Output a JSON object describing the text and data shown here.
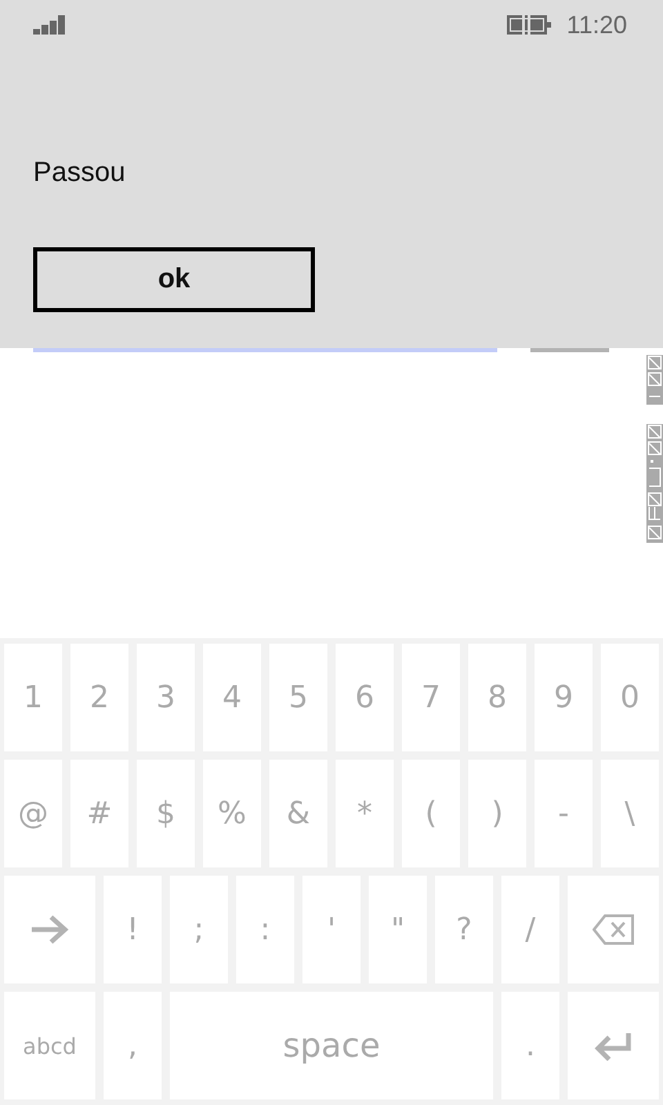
{
  "status_bar": {
    "time": "11:20"
  },
  "dialog": {
    "message": "Passou",
    "button": "ok"
  },
  "keyboard": {
    "key_rows": [
      {
        "keys": [
          {
            "kind": "char",
            "label": "1"
          },
          {
            "kind": "char",
            "label": "2"
          },
          {
            "kind": "char",
            "label": "3"
          },
          {
            "kind": "char",
            "label": "4"
          },
          {
            "kind": "char",
            "label": "5"
          },
          {
            "kind": "char",
            "label": "6"
          },
          {
            "kind": "char",
            "label": "7"
          },
          {
            "kind": "char",
            "label": "8"
          },
          {
            "kind": "char",
            "label": "9"
          },
          {
            "kind": "char",
            "label": "0"
          }
        ]
      },
      {
        "keys": [
          {
            "kind": "char",
            "label": "@"
          },
          {
            "kind": "char",
            "label": "#"
          },
          {
            "kind": "char",
            "label": "$"
          },
          {
            "kind": "char",
            "label": "%"
          },
          {
            "kind": "char",
            "label": "&"
          },
          {
            "kind": "char",
            "label": "*"
          },
          {
            "kind": "char",
            "label": "("
          },
          {
            "kind": "char",
            "label": ")"
          },
          {
            "kind": "char",
            "label": "-"
          },
          {
            "kind": "char",
            "label": "\\"
          }
        ]
      },
      {
        "keys": [
          {
            "kind": "arrow"
          },
          {
            "kind": "char",
            "label": "!"
          },
          {
            "kind": "char",
            "label": ";"
          },
          {
            "kind": "char",
            "label": ":"
          },
          {
            "kind": "char",
            "label": "'"
          },
          {
            "kind": "char",
            "label": "\""
          },
          {
            "kind": "char",
            "label": "?"
          },
          {
            "kind": "char",
            "label": "/"
          },
          {
            "kind": "backspace"
          }
        ]
      },
      {
        "keys": [
          {
            "kind": "wide",
            "label": "abcd"
          },
          {
            "kind": "char",
            "label": ","
          },
          {
            "kind": "space",
            "label": "space"
          },
          {
            "kind": "char",
            "label": "."
          },
          {
            "kind": "enter"
          }
        ]
      }
    ]
  }
}
